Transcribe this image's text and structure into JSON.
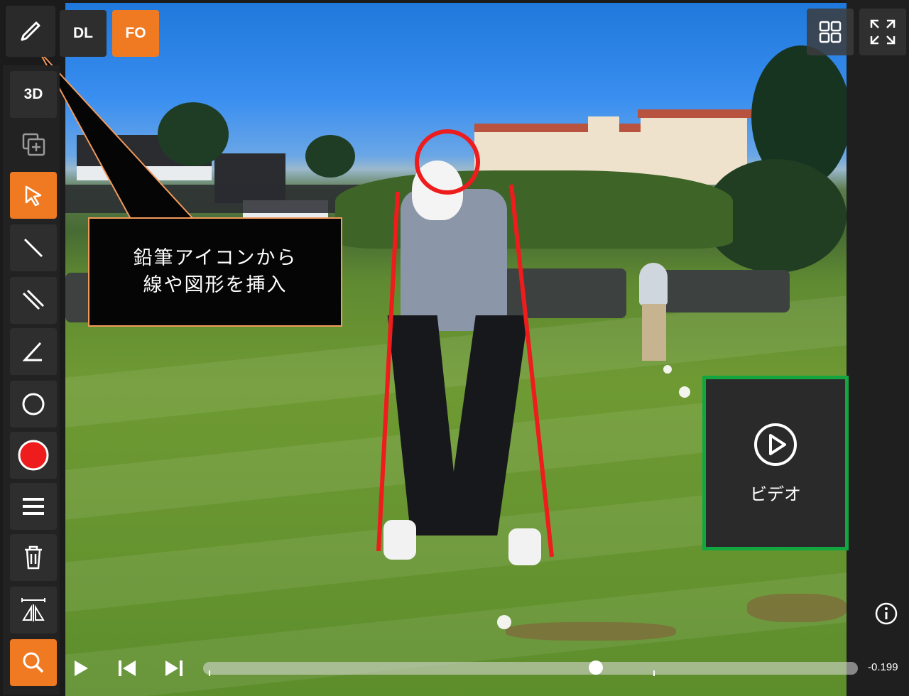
{
  "top_buttons": {
    "dl_label": "DL",
    "fo_label": "FO"
  },
  "toolbar": {
    "three_d_label": "3D",
    "items": [
      {
        "name": "3d-view",
        "icon": "3d-text"
      },
      {
        "name": "add-layer",
        "icon": "add-layer-icon"
      },
      {
        "name": "select",
        "icon": "cursor-icon",
        "active": true
      },
      {
        "name": "line",
        "icon": "line-icon"
      },
      {
        "name": "parallel-lines",
        "icon": "double-line-icon"
      },
      {
        "name": "angle",
        "icon": "angle-icon"
      },
      {
        "name": "circle",
        "icon": "circle-icon"
      },
      {
        "name": "color",
        "icon": "color-swatch-icon",
        "color": "#ee1c1c"
      },
      {
        "name": "line-width",
        "icon": "menu-lines-icon"
      },
      {
        "name": "delete",
        "icon": "trash-icon"
      },
      {
        "name": "mirror",
        "icon": "mirror-icon"
      },
      {
        "name": "zoom",
        "icon": "search-icon",
        "active": true
      }
    ]
  },
  "callout": {
    "line1": "鉛筆アイコンから",
    "line2": "線や図形を挿入"
  },
  "video_panel": {
    "label": "ビデオ",
    "icon": "play-circle-icon"
  },
  "playback": {
    "time": "-0.199",
    "progress": 0.6
  },
  "colors": {
    "accent": "#f07a21",
    "annotation": "#ee1c1c",
    "highlight": "#13a640",
    "callout_border": "#f29a5c"
  }
}
